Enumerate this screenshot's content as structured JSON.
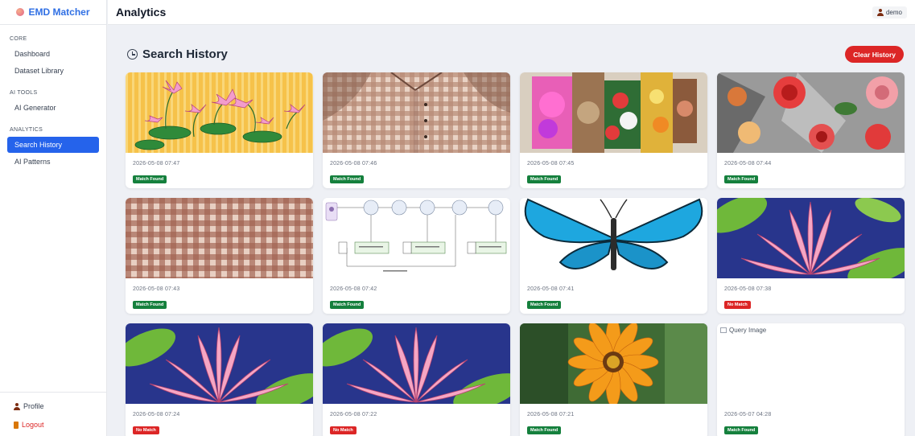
{
  "brand": {
    "name": "EMD Matcher"
  },
  "sidebar": {
    "sections": [
      {
        "title": "CORE",
        "items": [
          "Dashboard",
          "Dataset Library"
        ]
      },
      {
        "title": "AI TOOLS",
        "items": [
          "AI Generator"
        ]
      },
      {
        "title": "ANALYTICS",
        "items": [
          "Search History",
          "AI Patterns"
        ]
      }
    ],
    "active_item": "Search History",
    "profile_label": "Profile",
    "logout_label": "Logout"
  },
  "header": {
    "title": "Analytics",
    "user": "demo"
  },
  "main": {
    "section_title": "Search History",
    "clear_button": "Clear History",
    "cards": [
      {
        "date": "2026-05-08 07:47",
        "status": "Match Found",
        "matched": true,
        "image": "pink-lotus-illustration"
      },
      {
        "date": "2026-05-08 07:46",
        "status": "Match Found",
        "matched": true,
        "image": "gingham-dress"
      },
      {
        "date": "2026-05-08 07:45",
        "status": "Match Found",
        "matched": true,
        "image": "floral-collage"
      },
      {
        "date": "2026-05-08 07:44",
        "status": "Match Found",
        "matched": true,
        "image": "red-roses"
      },
      {
        "date": "2026-05-08 07:43",
        "status": "Match Found",
        "matched": true,
        "image": "gingham-fabric"
      },
      {
        "date": "2026-05-08 07:42",
        "status": "Match Found",
        "matched": true,
        "image": "flow-diagram"
      },
      {
        "date": "2026-05-08 07:41",
        "status": "Match Found",
        "matched": true,
        "image": "blue-butterfly"
      },
      {
        "date": "2026-05-08 07:38",
        "status": "No Match",
        "matched": false,
        "image": "lotus-embroidery"
      },
      {
        "date": "2026-05-08 07:24",
        "status": "No Match",
        "matched": false,
        "image": "lotus-embroidery"
      },
      {
        "date": "2026-05-08 07:22",
        "status": "No Match",
        "matched": false,
        "image": "lotus-embroidery"
      },
      {
        "date": "2026-05-08 07:21",
        "status": "Match Found",
        "matched": true,
        "image": "orange-gazania"
      },
      {
        "date": "2026-05-07 04:28",
        "status": "Match Found",
        "matched": true,
        "image": "broken",
        "alt": "Query Image"
      }
    ]
  },
  "colors": {
    "accent": "#2563eb",
    "brand": "#2f6fe4",
    "danger": "#dc2626",
    "success": "#15803d"
  }
}
